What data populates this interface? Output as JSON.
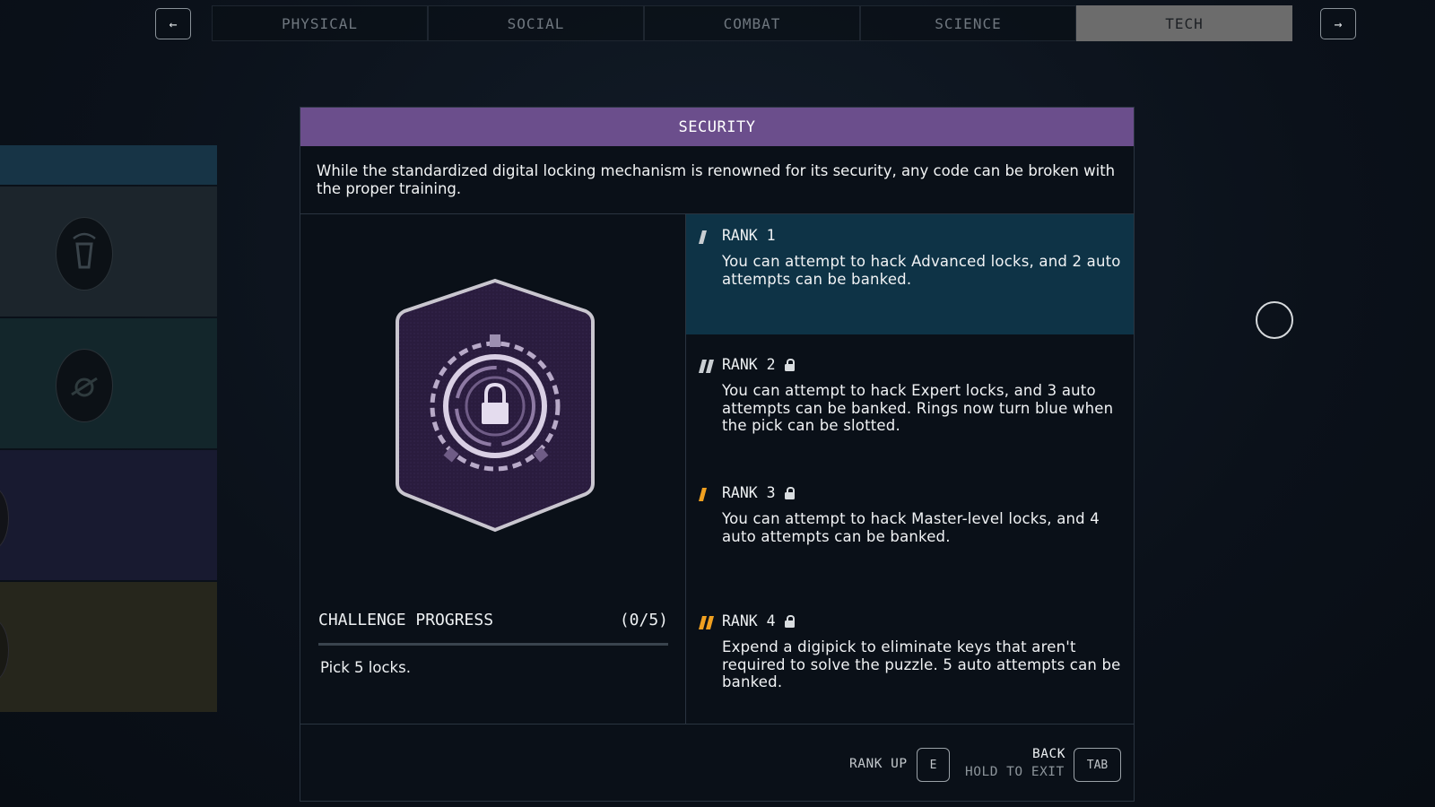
{
  "nav": {
    "prev_label": "←",
    "next_label": "→",
    "tabs": [
      {
        "label": "PHYSICAL",
        "active": false
      },
      {
        "label": "SOCIAL",
        "active": false
      },
      {
        "label": "COMBAT",
        "active": false
      },
      {
        "label": "SCIENCE",
        "active": false
      },
      {
        "label": "TECH",
        "active": true
      }
    ]
  },
  "skill": {
    "title": "SECURITY",
    "description": "While the standardized digital locking mechanism is renowned for its security, any code can be broken with the proper training.",
    "emblem_icon": "padlock-icon",
    "challenge": {
      "title": "CHALLENGE PROGRESS",
      "count": "(0/5)",
      "progress": 0,
      "description": "Pick 5 locks."
    },
    "ranks": [
      {
        "title": "RANK 1",
        "locked": false,
        "active": true,
        "description": "You can attempt to hack Advanced locks, and 2 auto attempts can be banked."
      },
      {
        "title": "RANK 2",
        "locked": true,
        "active": false,
        "description": "You can attempt to hack Expert locks, and 3 auto attempts can be banked. Rings now turn blue when the pick can be slotted."
      },
      {
        "title": "RANK 3",
        "locked": true,
        "active": false,
        "description": "You can attempt to hack Master-level locks, and 4 auto attempts can be banked."
      },
      {
        "title": "RANK 4",
        "locked": true,
        "active": false,
        "description": "Expend a digipick to eliminate keys that aren't required to solve the puzzle. 5 auto attempts can be banked."
      }
    ]
  },
  "footer": {
    "rank_up_label": "RANK UP",
    "rank_up_key": "E",
    "back_label": "BACK",
    "hold_label": "HOLD TO EXIT",
    "back_key": "TAB"
  },
  "colors": {
    "header_bg": "#6b4e8c",
    "rank_active_bg": "#0e3346",
    "rank_mark_gray": "#c9ced2",
    "rank_mark_orange": "#f0a020",
    "tab_active_bg": "#6c6c6c"
  }
}
